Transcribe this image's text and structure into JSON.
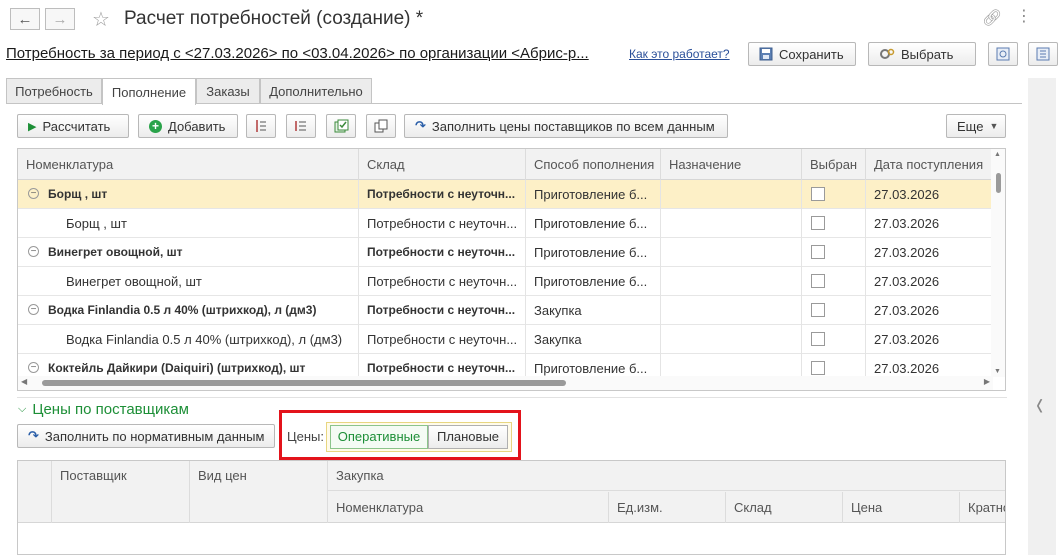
{
  "window": {
    "title": "Расчет потребностей (создание) *",
    "back_icon": "back-arrow-icon",
    "forward_icon": "forward-arrow-icon",
    "favorite_icon": "star-icon"
  },
  "header": {
    "period_link": "Потребность за период с <27.03.2026> по <03.04.2026> по организации <Абрис-р...",
    "how_link": "Как это работает?",
    "save_label": "Сохранить",
    "choose_label": "Выбрать"
  },
  "tabs": [
    {
      "label": "Потребность",
      "active": false
    },
    {
      "label": "Пополнение",
      "active": true
    },
    {
      "label": "Заказы",
      "active": false
    },
    {
      "label": "Дополнительно",
      "active": false
    }
  ],
  "toolbar": {
    "calculate": "Рассчитать",
    "add": "Добавить",
    "fill_prices": "Заполнить цены поставщиков по всем данным",
    "more": "Еще"
  },
  "grid": {
    "columns": [
      "Номенклатура",
      "Склад",
      "Способ пополнения",
      "Назначение",
      "Выбран",
      "Дата поступления"
    ],
    "rows": [
      {
        "name": "Борщ , шт",
        "warehouse": "Потребности с неуточн...",
        "method": "Приготовление б...",
        "purpose": "",
        "date": "27.03.2026",
        "group": true,
        "selected": true
      },
      {
        "name": "Борщ , шт",
        "warehouse": "Потребности с неуточн...",
        "method": "Приготовление б...",
        "purpose": "",
        "date": "27.03.2026",
        "group": false,
        "selected": false
      },
      {
        "name": "Винегрет овощной, шт",
        "warehouse": "Потребности с неуточн...",
        "method": "Приготовление б...",
        "purpose": "",
        "date": "27.03.2026",
        "group": true,
        "selected": false
      },
      {
        "name": "Винегрет овощной, шт",
        "warehouse": "Потребности с неуточн...",
        "method": "Приготовление б...",
        "purpose": "",
        "date": "27.03.2026",
        "group": false,
        "selected": false
      },
      {
        "name": "Водка Finlandia 0.5 л 40% (штрихкод), л (дм3)",
        "warehouse": "Потребности с неуточн...",
        "method": "Закупка",
        "purpose": "",
        "date": "27.03.2026",
        "group": true,
        "selected": false
      },
      {
        "name": "Водка Finlandia 0.5 л 40% (штрихкод), л (дм3)",
        "warehouse": "Потребности с неуточн...",
        "method": "Закупка",
        "purpose": "",
        "date": "27.03.2026",
        "group": false,
        "selected": false
      },
      {
        "name": "Коктейль Дайкири (Daiquiri) (штрихкод), шт",
        "warehouse": "Потребности с неуточн...",
        "method": "Приготовление б...",
        "purpose": "",
        "date": "27.03.2026",
        "group": true,
        "selected": false
      }
    ]
  },
  "supplier_prices": {
    "section_title": "Цены по поставщикам",
    "fill_normative": "Заполнить по нормативным данным",
    "prices_label": "Цены:",
    "mode_operative": "Оперативные",
    "mode_planned": "Плановые",
    "highlight_color": "#e3131b",
    "columns_top": [
      "Поставщик",
      "Вид цен",
      "Закупка"
    ],
    "columns_sub": [
      "Номенклатура",
      "Ед.изм.",
      "Склад",
      "Цена",
      "Кратно"
    ]
  },
  "colors": {
    "accent_green": "#1d8f37",
    "selected_row": "#fdf0c7",
    "link": "#2a4f99"
  }
}
